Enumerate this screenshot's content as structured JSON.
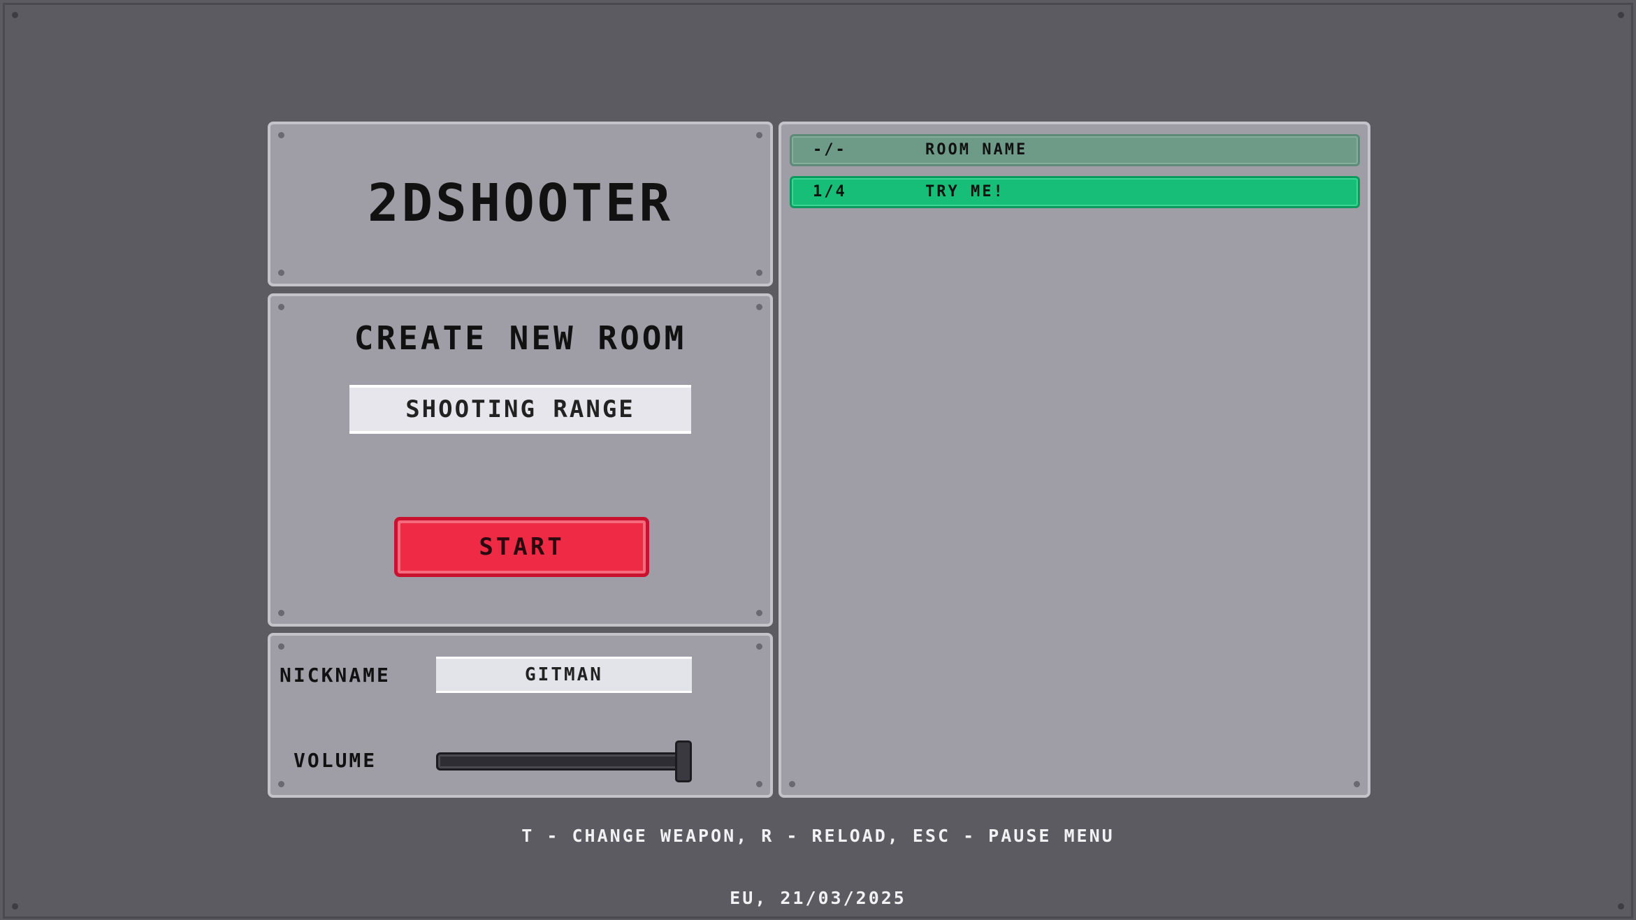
{
  "game": {
    "title": "2DSHOOTER"
  },
  "create_room": {
    "heading": "CREATE NEW ROOM",
    "room_name_value": "SHOOTING RANGE",
    "start_label": "START"
  },
  "settings": {
    "nickname_label": "NICKNAME",
    "nickname_value": "GITMAN",
    "volume_label": "VOLUME",
    "volume_level": 1.0
  },
  "room_list": {
    "header": {
      "players": "-/-",
      "name": "ROOM NAME"
    },
    "rooms": [
      {
        "players": "1/4",
        "name": "TRY ME!"
      }
    ]
  },
  "footer": {
    "controls_hint": "T - CHANGE WEAPON,  R - RELOAD, ESC - PAUSE MENU",
    "server_date": "EU, 21/03/2025"
  },
  "colors": {
    "background": "#5c5b61",
    "panel": "#9f9ea6",
    "start_button": "#ee2a45",
    "room_selected": "#17be78",
    "room_header": "#6e9a88"
  }
}
